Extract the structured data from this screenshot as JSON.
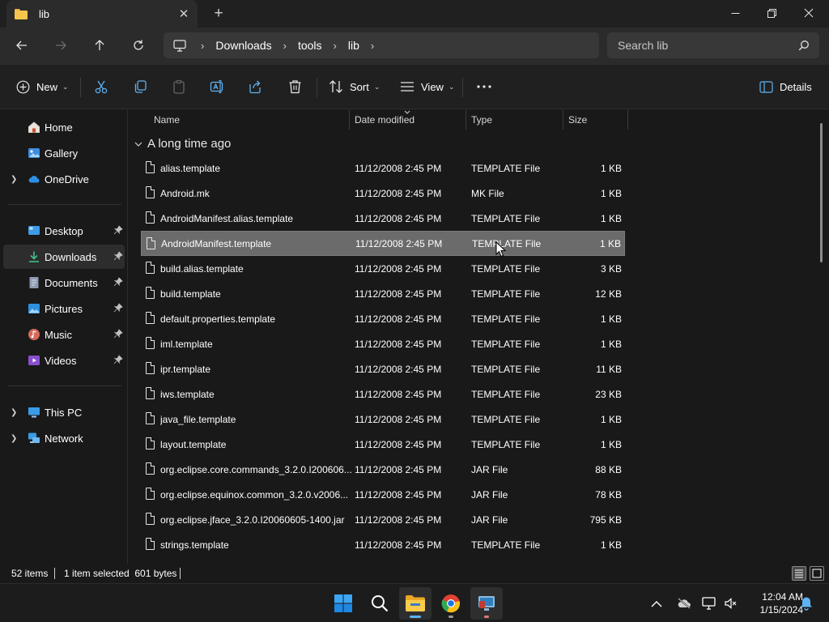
{
  "window": {
    "tab_title": "lib",
    "tab_icon": "folder-icon",
    "new_tab_glyph": "+",
    "close_tab_glyph": "✕"
  },
  "address": {
    "breadcrumbs": [
      "Downloads",
      "tools",
      "lib"
    ],
    "search_placeholder": "Search lib"
  },
  "commands": {
    "new": "New",
    "sort": "Sort",
    "view": "View",
    "details": "Details"
  },
  "sidebar": {
    "items": [
      {
        "label": "Home",
        "icon": "home-icon"
      },
      {
        "label": "Gallery",
        "icon": "gallery-icon"
      },
      {
        "label": "OneDrive",
        "icon": "cloud-icon"
      },
      {
        "label": "Desktop",
        "icon": "desktop-icon"
      },
      {
        "label": "Downloads",
        "icon": "download-icon"
      },
      {
        "label": "Documents",
        "icon": "documents-icon"
      },
      {
        "label": "Pictures",
        "icon": "pictures-icon"
      },
      {
        "label": "Music",
        "icon": "music-icon"
      },
      {
        "label": "Videos",
        "icon": "videos-icon"
      },
      {
        "label": "This PC",
        "icon": "computer-icon"
      },
      {
        "label": "Network",
        "icon": "network-icon"
      }
    ]
  },
  "columns": {
    "name": "Name",
    "date": "Date modified",
    "type": "Type",
    "size": "Size"
  },
  "group": {
    "title": "A long time ago"
  },
  "files": [
    {
      "name": "alias.template",
      "date": "11/12/2008 2:45 PM",
      "type": "TEMPLATE File",
      "size": "1 KB"
    },
    {
      "name": "Android.mk",
      "date": "11/12/2008 2:45 PM",
      "type": "MK File",
      "size": "1 KB"
    },
    {
      "name": "AndroidManifest.alias.template",
      "date": "11/12/2008 2:45 PM",
      "type": "TEMPLATE File",
      "size": "1 KB"
    },
    {
      "name": "AndroidManifest.template",
      "date": "11/12/2008 2:45 PM",
      "type": "TEMPLATE File",
      "size": "1 KB",
      "selected": true
    },
    {
      "name": "build.alias.template",
      "date": "11/12/2008 2:45 PM",
      "type": "TEMPLATE File",
      "size": "3 KB"
    },
    {
      "name": "build.template",
      "date": "11/12/2008 2:45 PM",
      "type": "TEMPLATE File",
      "size": "12 KB"
    },
    {
      "name": "default.properties.template",
      "date": "11/12/2008 2:45 PM",
      "type": "TEMPLATE File",
      "size": "1 KB"
    },
    {
      "name": "iml.template",
      "date": "11/12/2008 2:45 PM",
      "type": "TEMPLATE File",
      "size": "1 KB"
    },
    {
      "name": "ipr.template",
      "date": "11/12/2008 2:45 PM",
      "type": "TEMPLATE File",
      "size": "11 KB"
    },
    {
      "name": "iws.template",
      "date": "11/12/2008 2:45 PM",
      "type": "TEMPLATE File",
      "size": "23 KB"
    },
    {
      "name": "java_file.template",
      "date": "11/12/2008 2:45 PM",
      "type": "TEMPLATE File",
      "size": "1 KB"
    },
    {
      "name": "layout.template",
      "date": "11/12/2008 2:45 PM",
      "type": "TEMPLATE File",
      "size": "1 KB"
    },
    {
      "name": "org.eclipse.core.commands_3.2.0.I200606...",
      "date": "11/12/2008 2:45 PM",
      "type": "JAR File",
      "size": "88 KB"
    },
    {
      "name": "org.eclipse.equinox.common_3.2.0.v2006...",
      "date": "11/12/2008 2:45 PM",
      "type": "JAR File",
      "size": "78 KB"
    },
    {
      "name": "org.eclipse.jface_3.2.0.I20060605-1400.jar",
      "date": "11/12/2008 2:45 PM",
      "type": "JAR File",
      "size": "795 KB"
    },
    {
      "name": "strings.template",
      "date": "11/12/2008 2:45 PM",
      "type": "TEMPLATE File",
      "size": "1 KB"
    }
  ],
  "status": {
    "items": "52 items",
    "selected": "1 item selected  601 bytes"
  },
  "taskbar": {
    "time": "12:04 AM",
    "date": "1/15/2024"
  },
  "colors": {
    "accent": "#5fb2f2",
    "folder": "#f5c64c",
    "selection": "#6b6b6b"
  }
}
